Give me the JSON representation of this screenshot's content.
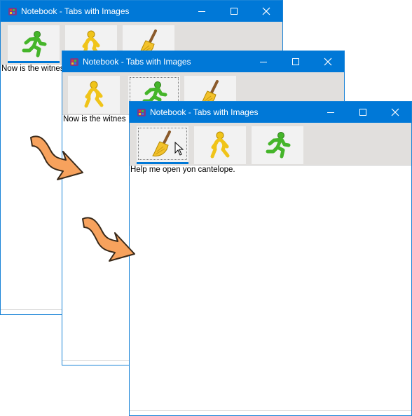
{
  "windows": [
    {
      "title": "Notebook - Tabs with Images",
      "tabs": [
        {
          "icon": "running-man-icon",
          "selected": true
        },
        {
          "icon": "walking-man-icon",
          "selected": false
        },
        {
          "icon": "broom-icon",
          "selected": false
        }
      ],
      "content_text": "Now is the witnes"
    },
    {
      "title": "Notebook - Tabs with Images",
      "tabs": [
        {
          "icon": "walking-man-icon",
          "selected": false
        },
        {
          "icon": "running-man-icon",
          "selected": true
        },
        {
          "icon": "broom-icon",
          "selected": false
        }
      ],
      "content_text": "Now is the witnes"
    },
    {
      "title": "Notebook - Tabs with Images",
      "tabs": [
        {
          "icon": "broom-icon",
          "selected": true
        },
        {
          "icon": "walking-man-icon",
          "selected": false
        },
        {
          "icon": "running-man-icon",
          "selected": false
        }
      ],
      "content_text": "Help me open yon cantelope."
    }
  ],
  "colors": {
    "titlebar": "#0078d7",
    "tab_underline": "#0078d7",
    "arrow_fill": "#f7a25d",
    "arrow_stroke": "#3a2a1a",
    "running_man": "#45b52a",
    "walking_man": "#f0c419",
    "broom": "#f3c22b"
  }
}
